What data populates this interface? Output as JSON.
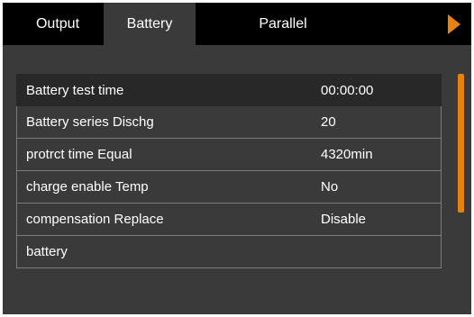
{
  "tabs": [
    {
      "label": "Output"
    },
    {
      "label": "Battery"
    },
    {
      "label": "Parallel"
    }
  ],
  "active_tab": "Battery",
  "settings": [
    {
      "label": "Battery test time",
      "value": "00:00:00"
    },
    {
      "label": "Battery series Dischg",
      "value": "20"
    },
    {
      "label": "protrct time Equal",
      "value": "4320min"
    },
    {
      "label": "charge enable Temp",
      "value": "No"
    },
    {
      "label": "compensation Replace",
      "value": "Disable"
    },
    {
      "label": "battery",
      "value": ""
    }
  ],
  "colors": {
    "accent": "#e8820e",
    "tab_bar": "#000000",
    "panel": "#3a3a3a",
    "selected_row": "#282828"
  },
  "icons": {
    "next": "triangle-right-icon"
  }
}
